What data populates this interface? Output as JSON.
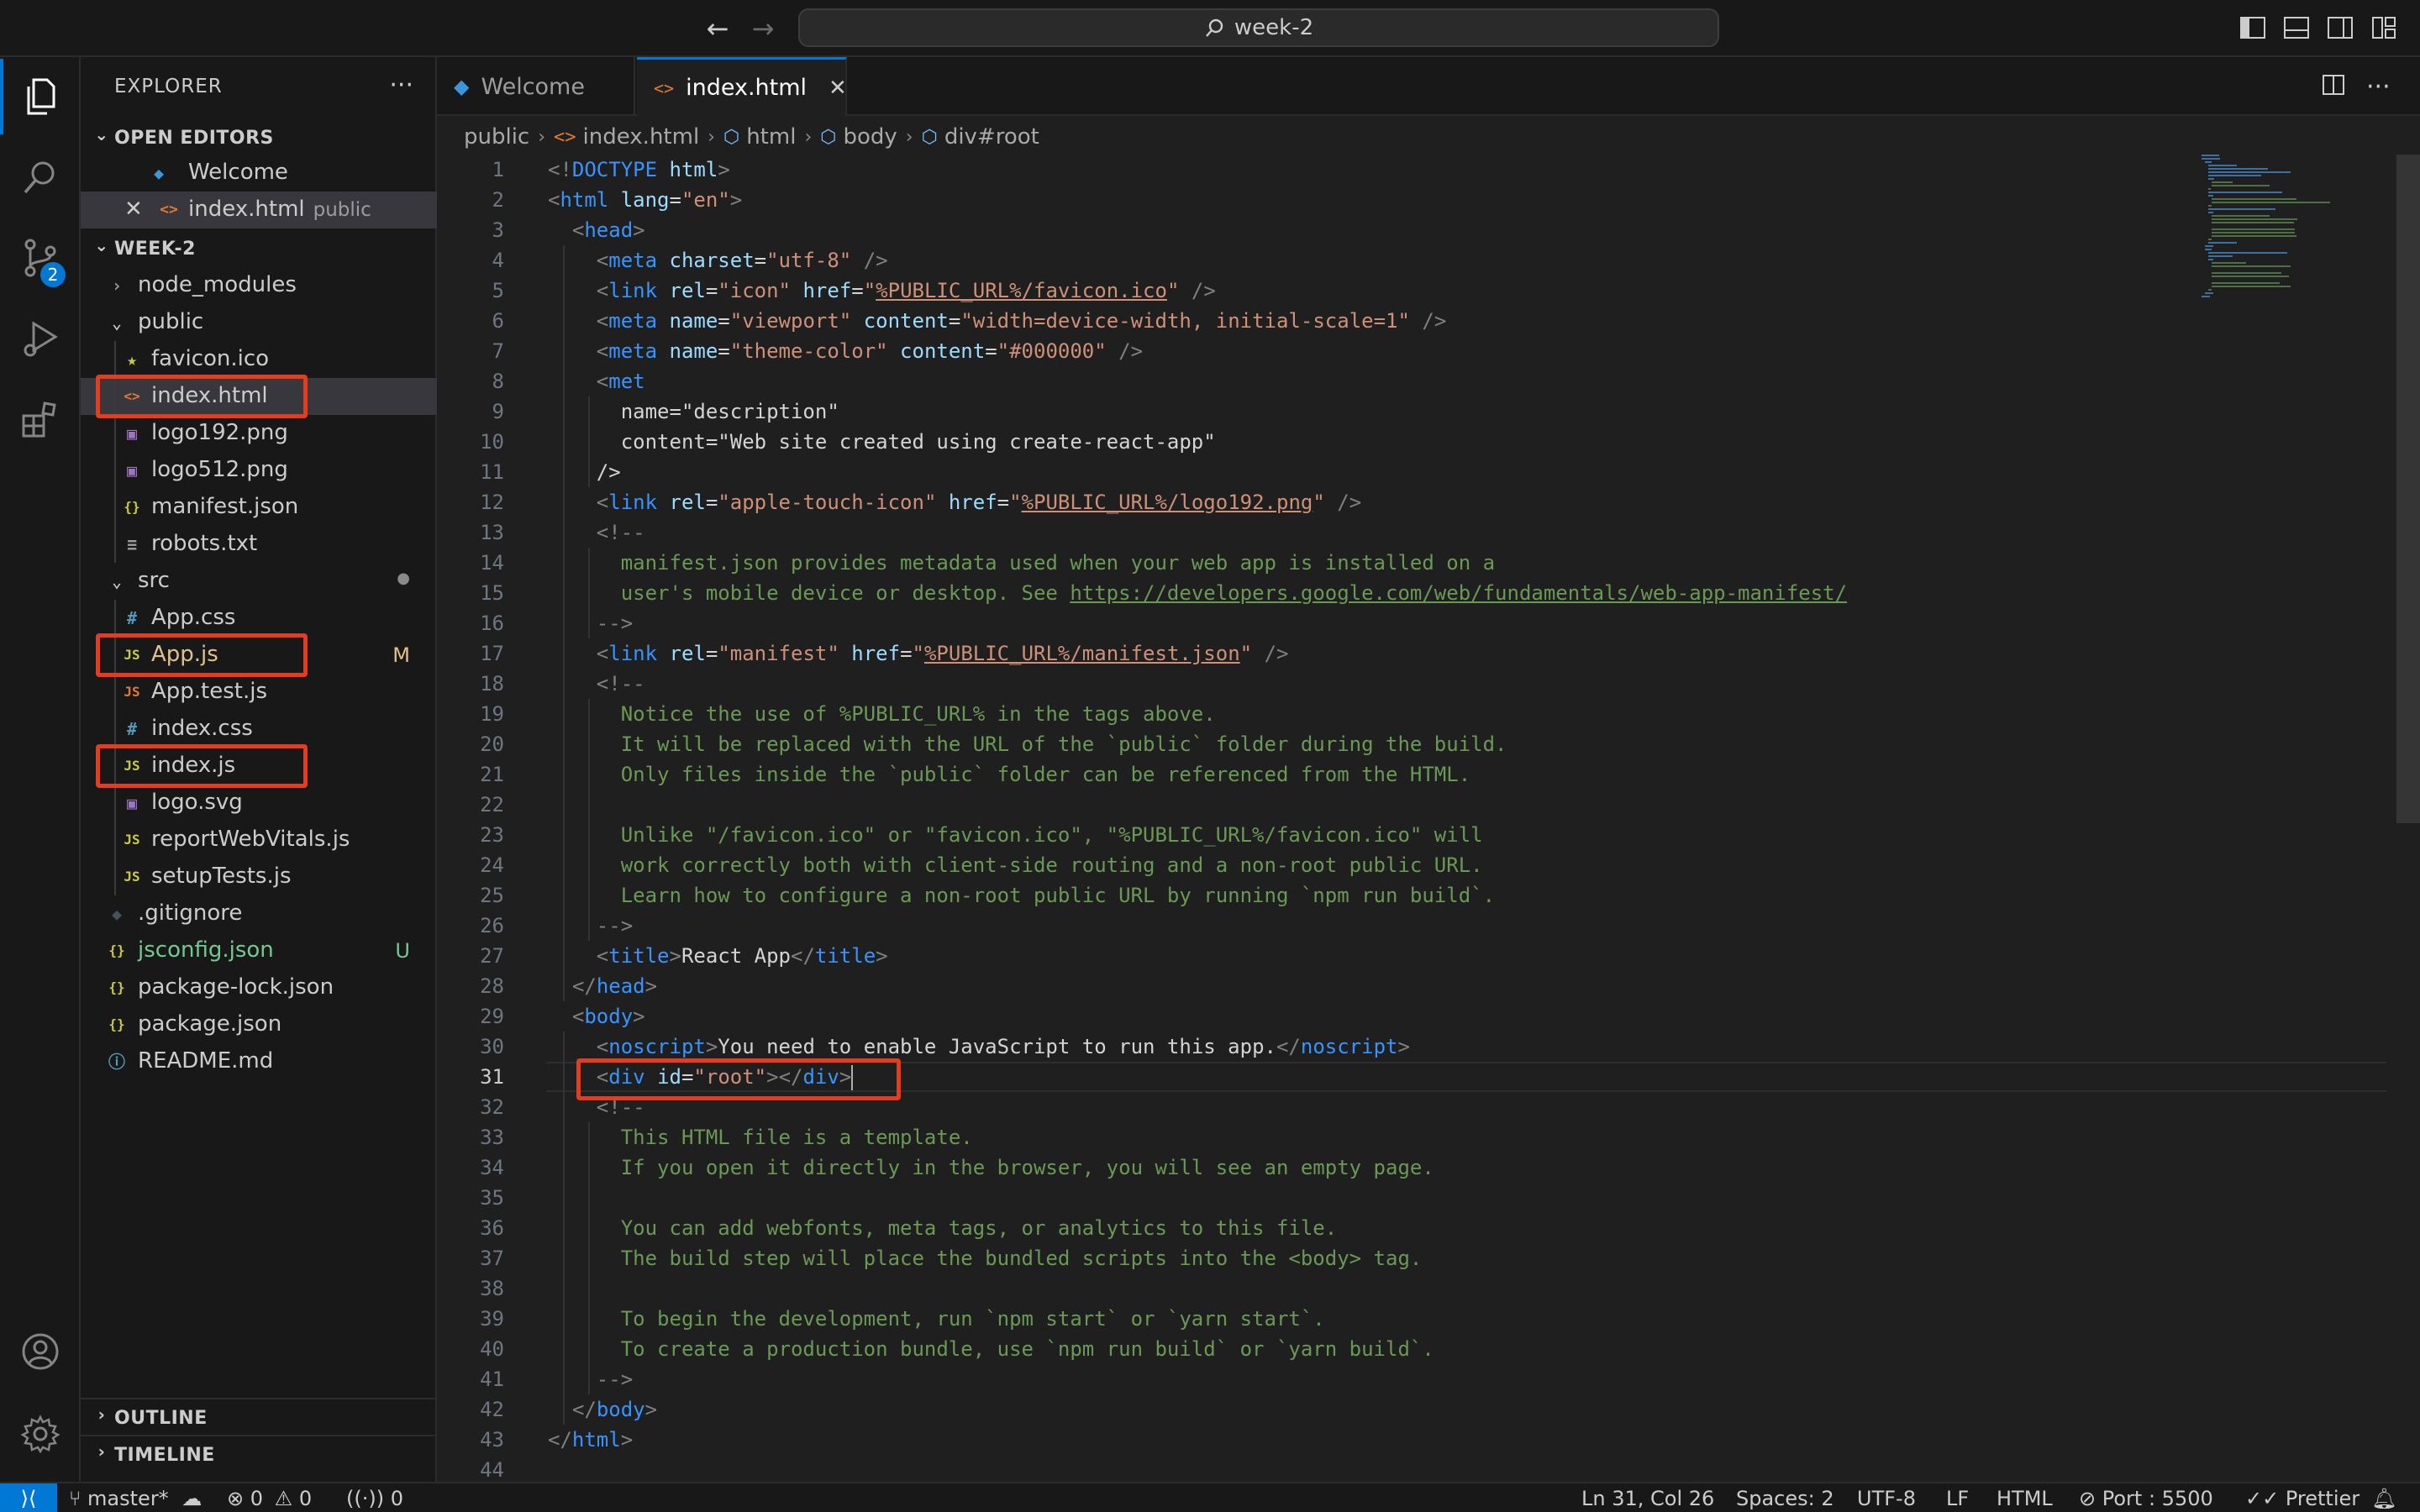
{
  "titlebar": {
    "search": "week-2"
  },
  "activity": {
    "scm_badge": "2"
  },
  "explorer": {
    "title": "EXPLORER",
    "more": "···",
    "open_editors": {
      "label": "OPEN EDITORS",
      "items": [
        {
          "name": "Welcome",
          "sub": ""
        },
        {
          "name": "index.html",
          "sub": "public"
        }
      ]
    },
    "workspace": {
      "label": "WEEK-2",
      "items": [
        {
          "name": "node_modules",
          "icon": "folder-chevron-right-icon",
          "glyph": "›",
          "color": "#9d9d9d"
        },
        {
          "name": "public",
          "icon": "folder-chevron-down-icon",
          "glyph": "⌄",
          "color": "#cccccc"
        },
        {
          "name": "favicon.ico",
          "icon": "star-icon",
          "glyph": "★",
          "color": "#cbcb41"
        },
        {
          "name": "index.html",
          "icon": "html-icon",
          "glyph": "<>",
          "color": "#e37933"
        },
        {
          "name": "logo192.png",
          "icon": "image-icon",
          "glyph": "▣",
          "color": "#a074c4"
        },
        {
          "name": "logo512.png",
          "icon": "image-icon",
          "glyph": "▣",
          "color": "#a074c4"
        },
        {
          "name": "manifest.json",
          "icon": "json-icon",
          "glyph": "{}",
          "color": "#cbcb41"
        },
        {
          "name": "robots.txt",
          "icon": "text-file-icon",
          "glyph": "≡",
          "color": "#9d9d9d"
        },
        {
          "name": "src",
          "icon": "folder-chevron-down-icon",
          "glyph": "⌄",
          "color": "#cccccc"
        },
        {
          "name": "App.css",
          "icon": "css-icon",
          "glyph": "#",
          "color": "#519aba"
        },
        {
          "name": "App.js",
          "icon": "js-icon",
          "glyph": "JS",
          "color": "#cbcb41"
        },
        {
          "name": "App.test.js",
          "icon": "js-icon",
          "glyph": "JS",
          "color": "#e37933"
        },
        {
          "name": "index.css",
          "icon": "css-icon",
          "glyph": "#",
          "color": "#519aba"
        },
        {
          "name": "index.js",
          "icon": "js-icon",
          "glyph": "JS",
          "color": "#cbcb41"
        },
        {
          "name": "logo.svg",
          "icon": "svg-icon",
          "glyph": "▣",
          "color": "#a074c4"
        },
        {
          "name": "reportWebVitals.js",
          "icon": "js-icon",
          "glyph": "JS",
          "color": "#cbcb41"
        },
        {
          "name": "setupTests.js",
          "icon": "js-icon",
          "glyph": "JS",
          "color": "#cbcb41"
        },
        {
          "name": ".gitignore",
          "icon": "git-icon",
          "glyph": "◆",
          "color": "#41535b"
        },
        {
          "name": "jsconfig.json",
          "icon": "json-icon",
          "glyph": "{}",
          "color": "#cbcb41"
        },
        {
          "name": "package-lock.json",
          "icon": "json-icon",
          "glyph": "{}",
          "color": "#cbcb41"
        },
        {
          "name": "package.json",
          "icon": "json-icon",
          "glyph": "{}",
          "color": "#cbcb41"
        },
        {
          "name": "README.md",
          "icon": "info-icon",
          "glyph": "ⓘ",
          "color": "#519aba"
        }
      ],
      "decorations": {
        "src": "●",
        "App.js": "M",
        "jsconfig.json": "U"
      }
    },
    "outline": "OUTLINE",
    "timeline": "TIMELINE"
  },
  "tabs": [
    {
      "label": "Welcome",
      "active": false
    },
    {
      "label": "index.html",
      "active": true
    }
  ],
  "breadcrumb": [
    "public",
    "index.html",
    "html",
    "body",
    "div#root"
  ],
  "editor": {
    "current_line": 31,
    "lines": [
      "<!DOCTYPE html>",
      "<html lang=\"en\">",
      "  <head>",
      "    <meta charset=\"utf-8\" />",
      "    <link rel=\"icon\" href=\"%PUBLIC_URL%/favicon.ico\" />",
      "    <meta name=\"viewport\" content=\"width=device-width, initial-scale=1\" />",
      "    <meta name=\"theme-color\" content=\"#000000\" />",
      "    <meta",
      "      name=\"description\"",
      "      content=\"Web site created using create-react-app\"",
      "    />",
      "    <link rel=\"apple-touch-icon\" href=\"%PUBLIC_URL%/logo192.png\" />",
      "    <!--",
      "      manifest.json provides metadata used when your web app is installed on a",
      "      user's mobile device or desktop. See https://developers.google.com/web/fundamentals/web-app-manifest/",
      "    -->",
      "    <link rel=\"manifest\" href=\"%PUBLIC_URL%/manifest.json\" />",
      "    <!--",
      "      Notice the use of %PUBLIC_URL% in the tags above.",
      "      It will be replaced with the URL of the `public` folder during the build.",
      "      Only files inside the `public` folder can be referenced from the HTML.",
      "",
      "      Unlike \"/favicon.ico\" or \"favicon.ico\", \"%PUBLIC_URL%/favicon.ico\" will",
      "      work correctly both with client-side routing and a non-root public URL.",
      "      Learn how to configure a non-root public URL by running `npm run build`.",
      "    -->",
      "    <title>React App</title>",
      "  </head>",
      "  <body>",
      "    <noscript>You need to enable JavaScript to run this app.</noscript>",
      "    <div id=\"root\"></div>",
      "    <!--",
      "      This HTML file is a template.",
      "      If you open it directly in the browser, you will see an empty page.",
      "",
      "      You can add webfonts, meta tags, or analytics to this file.",
      "      The build step will place the bundled scripts into the <body> tag.",
      "",
      "      To begin the development, run `npm start` or `yarn start`.",
      "      To create a production bundle, use `npm run build` or `yarn build`.",
      "    -->",
      "  </body>",
      "</html>",
      ""
    ]
  },
  "statusbar": {
    "branch": "master*",
    "errors": "0",
    "warnings": "0",
    "ports": "0",
    "position": "Ln 31, Col 26",
    "spaces": "Spaces: 2",
    "encoding": "UTF-8",
    "eol": "LF",
    "language": "HTML",
    "port": "Port : 5500",
    "formatter": "Prettier"
  },
  "colors": {
    "accent": "#0078d4",
    "highlight_box": "#e53b1f"
  }
}
